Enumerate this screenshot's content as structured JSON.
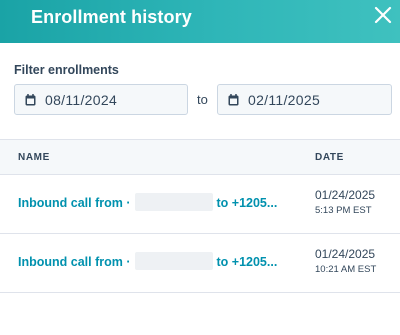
{
  "header": {
    "title": "Enrollment history",
    "close_icon": "close-icon",
    "background_color": "#2fb6b8"
  },
  "filter": {
    "label": "Filter enrollments",
    "from_date": "08/11/2024",
    "separator": "to",
    "to_date": "02/11/2025",
    "calendar_icon": "calendar-icon"
  },
  "table": {
    "columns": [
      "NAME",
      "DATE"
    ],
    "rows": [
      {
        "name_prefix": "Inbound call from ·",
        "name_suffix": "to +1205...",
        "date": "01/24/2025",
        "time": "5:13 PM EST"
      },
      {
        "name_prefix": "Inbound call from ·",
        "name_suffix": "to +1205...",
        "date": "01/24/2025",
        "time": "10:21 AM EST"
      }
    ]
  },
  "colors": {
    "link": "#0091ae",
    "text": "#33475b",
    "border": "#dfe3eb"
  }
}
